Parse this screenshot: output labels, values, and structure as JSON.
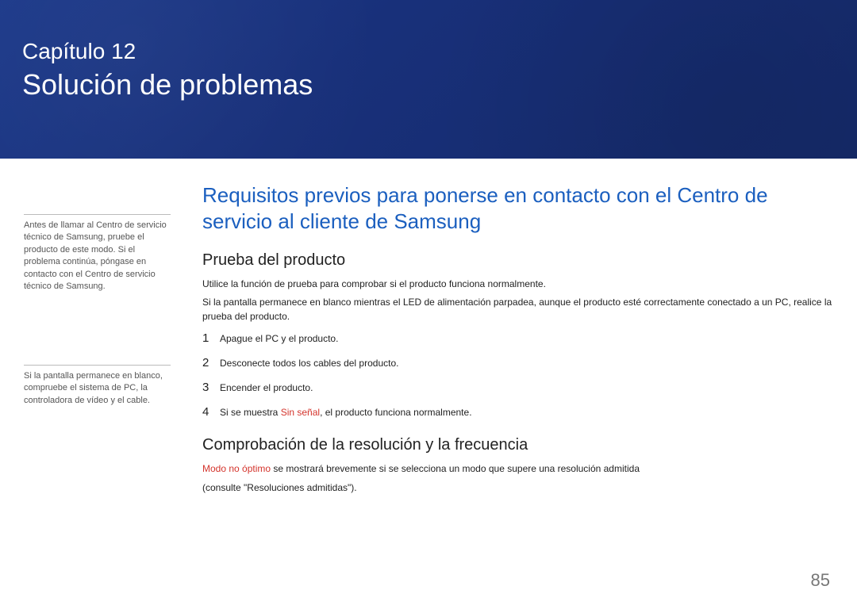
{
  "banner": {
    "chapter_label": "Capítulo 12",
    "chapter_title": "Solución de problemas"
  },
  "sidebar": {
    "note1": "Antes de llamar al Centro de servicio técnico de Samsung, pruebe el producto de este modo. Si el problema continúa, póngase en contacto con el Centro de servicio técnico de Samsung.",
    "note2": "Si la pantalla permanece en blanco, compruebe el sistema de PC, la controladora de vídeo y el cable."
  },
  "main": {
    "section_title": "Requisitos previos para ponerse en contacto con el Centro de servicio al cliente de Samsung",
    "product_test": {
      "heading": "Prueba del producto",
      "p1": "Utilice la función de prueba para comprobar si el producto funciona normalmente.",
      "p2": "Si la pantalla permanece en blanco mientras el LED de alimentación parpadea, aunque el producto esté correctamente conectado a un PC, realice la prueba del producto.",
      "steps": [
        {
          "num": "1",
          "text": "Apague el PC y el producto."
        },
        {
          "num": "2",
          "text": "Desconecte todos los cables del producto."
        },
        {
          "num": "3",
          "text": "Encender el producto."
        },
        {
          "num": "4",
          "prefix": "Si se muestra ",
          "highlight": "Sin señal",
          "suffix": ", el producto funciona normalmente."
        }
      ]
    },
    "resolution_check": {
      "heading": "Comprobación de la resolución y la frecuencia",
      "highlight": "Modo no óptimo",
      "p1_rest": " se mostrará brevemente si se selecciona un modo que supere una resolución admitida",
      "p2": "(consulte \"Resoluciones admitidas\")."
    }
  },
  "page_number": "85"
}
